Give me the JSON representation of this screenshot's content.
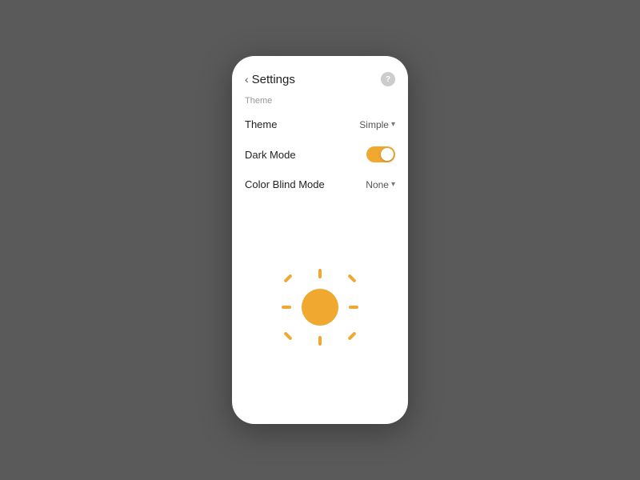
{
  "header": {
    "back_label": "‹",
    "title": "Settings",
    "help_label": "?"
  },
  "section": {
    "theme_group_label": "Theme"
  },
  "rows": [
    {
      "label": "Theme",
      "value": "Simple",
      "type": "dropdown"
    },
    {
      "label": "Dark Mode",
      "value": "",
      "type": "toggle",
      "toggle_on": true
    },
    {
      "label": "Color Blind Mode",
      "value": "None",
      "type": "dropdown"
    }
  ]
}
